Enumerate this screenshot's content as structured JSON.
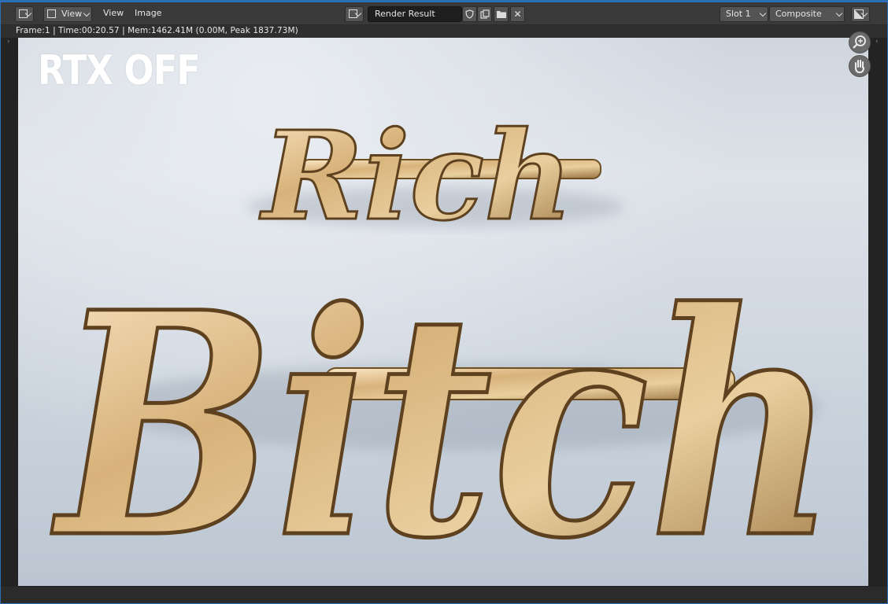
{
  "header": {
    "editor_type_icon": "image-editor-icon",
    "view_mode_label": "View",
    "menus": [
      "View",
      "Image"
    ],
    "image_browse_icon": "image-browse-icon",
    "image_name": "Render Result",
    "slot": "Slot 1",
    "layer": "Composite",
    "display_channels_icon": "display-channels-icon"
  },
  "status": {
    "text": "Frame:1 | Time:00:20.57 | Mem:1462.41M (0.00M, Peak 1837.73M)"
  },
  "render": {
    "overlay_title": "RTX OFF",
    "word_top": "Rich",
    "word_bottom": "Bitch"
  },
  "colors": {
    "accent": "#2a6fb8",
    "header_bg": "#3a3a3a",
    "gold": "#c9a56b",
    "background": "#d3dae2"
  }
}
